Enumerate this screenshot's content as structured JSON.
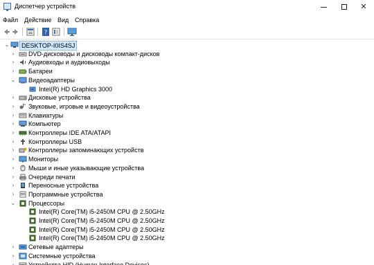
{
  "window": {
    "title": "Диспетчер устройств"
  },
  "menu": [
    {
      "key": "file",
      "label": "Файл"
    },
    {
      "key": "action",
      "label": "Действие"
    },
    {
      "key": "view",
      "label": "Вид"
    },
    {
      "key": "help",
      "label": "Справка"
    }
  ],
  "toolbar": [
    "back-icon",
    "forward-icon",
    "properties-icon",
    "help-icon",
    "view-icon",
    "monitor-icon"
  ],
  "tree": {
    "root": "DESKTOP-I0IS4SJ",
    "items": [
      {
        "label": "DVD-дисководы и дисководы компакт-дисков",
        "icon": "dvd-icon",
        "expanded": false
      },
      {
        "label": "Аудиовходы и аудиовыходы",
        "icon": "speaker-icon",
        "expanded": false
      },
      {
        "label": "Батареи",
        "icon": "battery-icon",
        "expanded": false
      },
      {
        "label": "Видеоадаптеры",
        "icon": "display-adapter-icon",
        "expanded": true,
        "children": [
          "Intel(R) HD Graphics 3000"
        ]
      },
      {
        "label": "Дисковые устройства",
        "icon": "disk-icon",
        "expanded": false
      },
      {
        "label": "Звуковые, игровые и видеоустройства",
        "icon": "sound-icon",
        "expanded": false
      },
      {
        "label": "Клавиатуры",
        "icon": "keyboard-icon",
        "expanded": false
      },
      {
        "label": "Компьютер",
        "icon": "computer-icon",
        "expanded": false
      },
      {
        "label": "Контроллеры IDE ATA/ATAPI",
        "icon": "ide-controller-icon",
        "expanded": false
      },
      {
        "label": "Контроллеры USB",
        "icon": "usb-icon",
        "expanded": false
      },
      {
        "label": "Контроллеры запоминающих устройств",
        "icon": "storage-controller-icon",
        "expanded": false
      },
      {
        "label": "Мониторы",
        "icon": "monitor-icon",
        "expanded": false
      },
      {
        "label": "Мыши и иные указывающие устройства",
        "icon": "mouse-icon",
        "expanded": false
      },
      {
        "label": "Очереди печати",
        "icon": "printer-icon",
        "expanded": false
      },
      {
        "label": "Переносные устройства",
        "icon": "portable-device-icon",
        "expanded": false
      },
      {
        "label": "Программные устройства",
        "icon": "software-device-icon",
        "expanded": false
      },
      {
        "label": "Процессоры",
        "icon": "processor-icon",
        "expanded": true,
        "children": [
          "Intel(R) Core(TM) i5-2450M CPU @ 2.50GHz",
          "Intel(R) Core(TM) i5-2450M CPU @ 2.50GHz",
          "Intel(R) Core(TM) i5-2450M CPU @ 2.50GHz",
          "Intel(R) Core(TM) i5-2450M CPU @ 2.50GHz"
        ]
      },
      {
        "label": "Сетевые адаптеры",
        "icon": "network-adapter-icon",
        "expanded": false
      },
      {
        "label": "Системные устройства",
        "icon": "system-device-icon",
        "expanded": false
      },
      {
        "label": "Устройства HID (Human Interface Devices)",
        "icon": "hid-icon",
        "expanded": false
      }
    ]
  },
  "colors": {
    "selection": "#cde8ff",
    "accent": "#3b6fb6",
    "processor": "#4a7a2a"
  }
}
